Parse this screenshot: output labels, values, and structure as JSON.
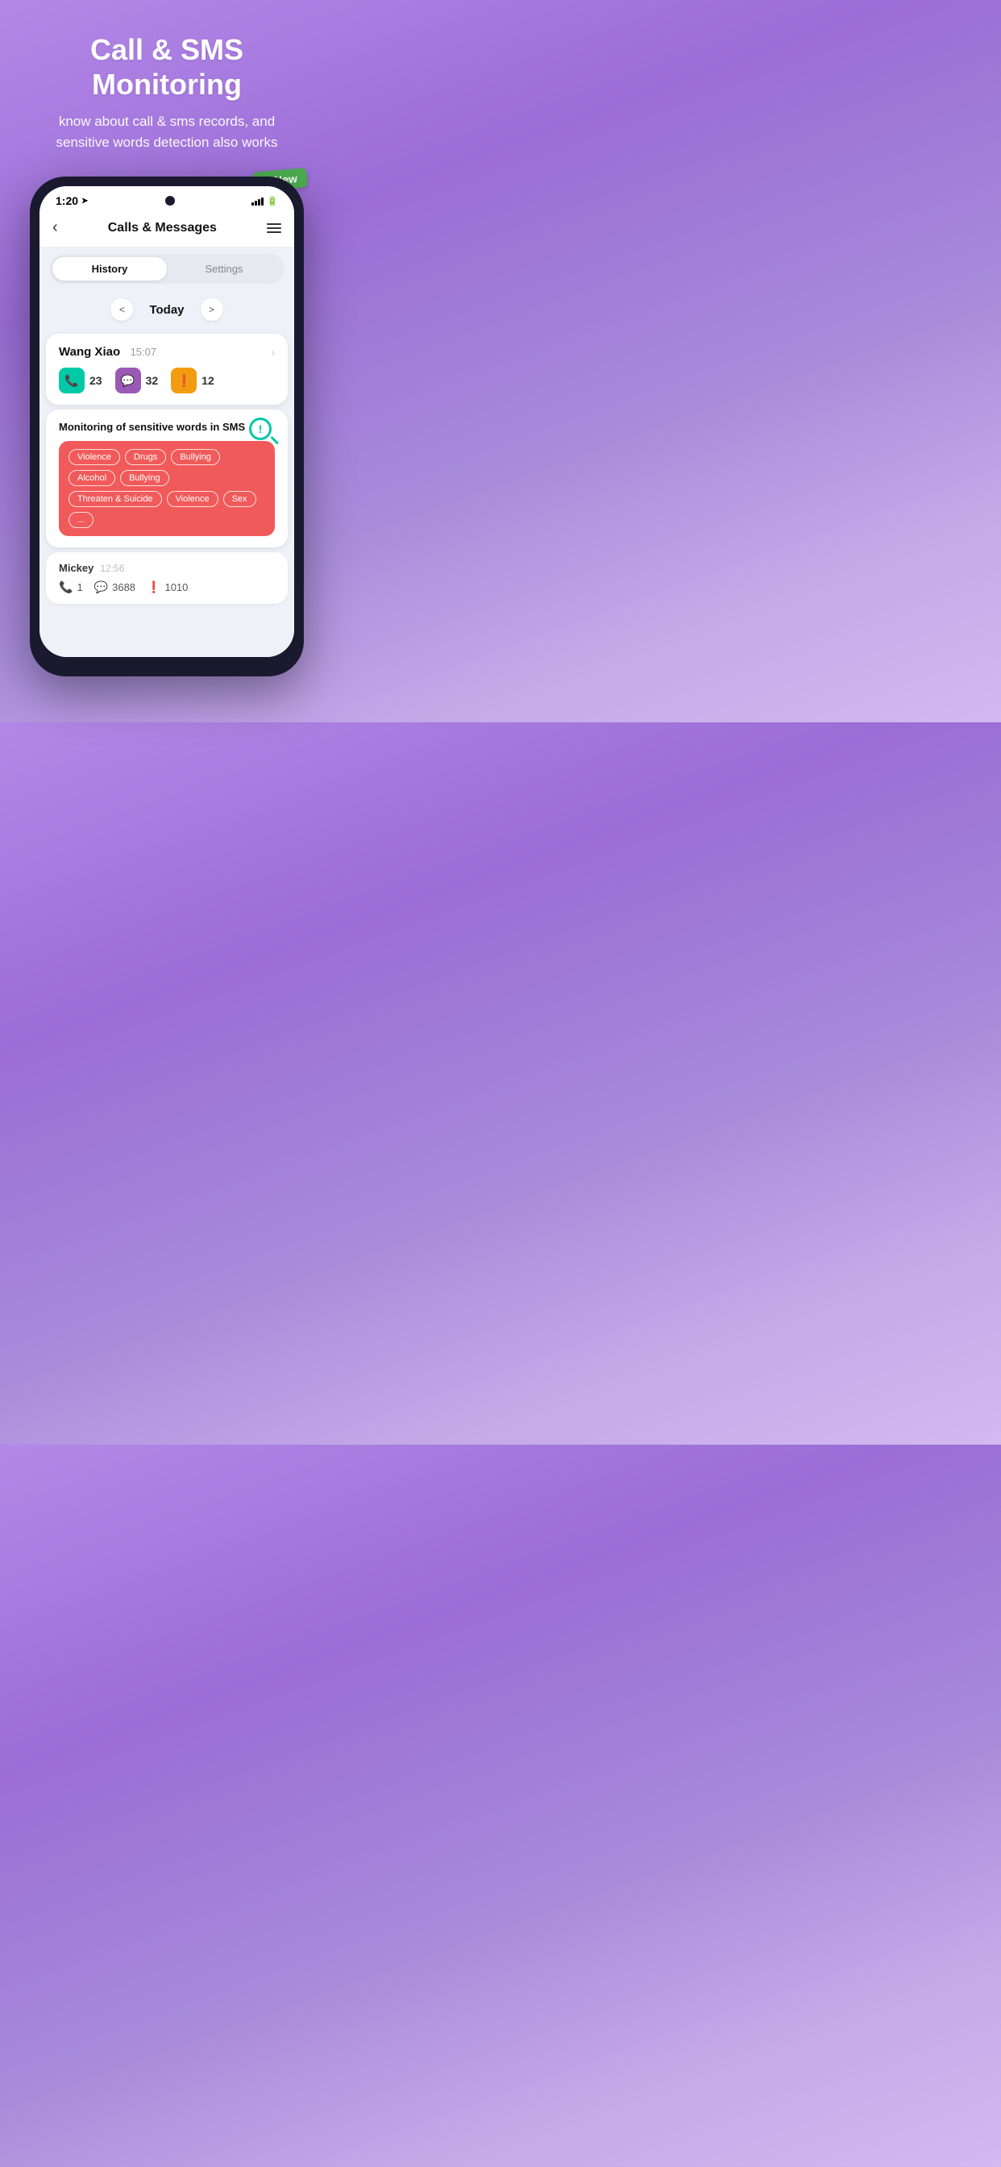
{
  "header": {
    "main_title": "Call & SMS Monitoring",
    "sub_title": "know about call & sms records, and\nsensitive words detection also works"
  },
  "new_badge": {
    "label": "New"
  },
  "phone": {
    "status_bar": {
      "time": "1:20",
      "camera": true
    },
    "app_header": {
      "title": "Calls & Messages",
      "back_label": "‹"
    },
    "tabs": [
      {
        "label": "History",
        "active": true
      },
      {
        "label": "Settings",
        "active": false
      }
    ],
    "date_nav": {
      "label": "Today",
      "prev": "<",
      "next": ">"
    },
    "wang_xiao_card": {
      "name": "Wang Xiao",
      "time": "15:07",
      "call_count": "23",
      "msg_count": "32",
      "alert_count": "12"
    },
    "sensitive_panel": {
      "title": "Monitoring of sensitive words in SMS",
      "tags": [
        "Violence",
        "Drugs",
        "Bullying",
        "Alcohol",
        "Bullying",
        "Threaten & Suicide",
        "Violence",
        "Sex",
        "..."
      ]
    },
    "mickey_card": {
      "name": "Mickey",
      "time": "12:56",
      "call_count": "1",
      "msg_count": "3688",
      "alert_count": "1010"
    }
  }
}
